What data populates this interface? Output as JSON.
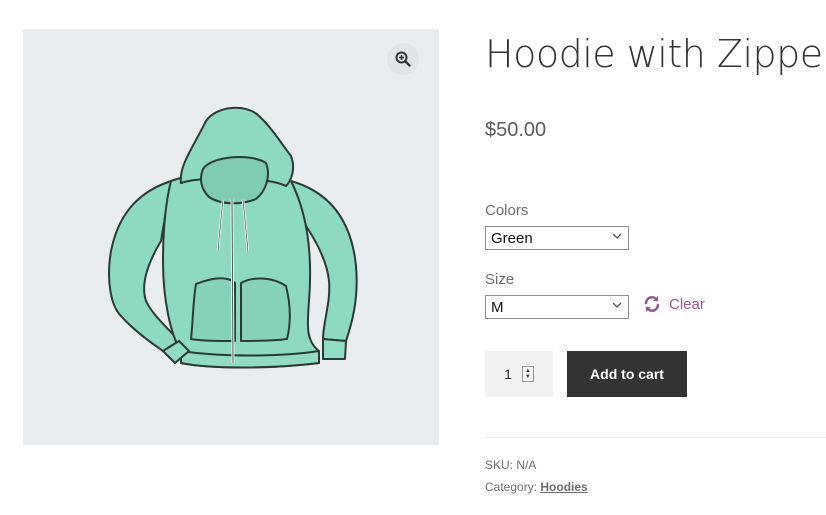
{
  "product": {
    "title": "Hoodie with Zipper",
    "price": "$50.00",
    "image_icon": "hoodie-illustration",
    "zoom_icon": "zoom-magnifier-icon"
  },
  "variations": {
    "colors_label": "Colors",
    "colors_selected": "Green",
    "size_label": "Size",
    "size_selected": "M",
    "clear_label": "Clear"
  },
  "cart": {
    "quantity": "1",
    "add_to_cart_label": "Add to cart"
  },
  "meta": {
    "sku_label": "SKU:",
    "sku_value": "N/A",
    "category_label": "Category:",
    "category_value": "Hoodies"
  },
  "colors": {
    "accent": "#96588a",
    "button": "#333333",
    "hoodie": "#8dd9c2",
    "gallery_bg": "#eaedf0"
  }
}
